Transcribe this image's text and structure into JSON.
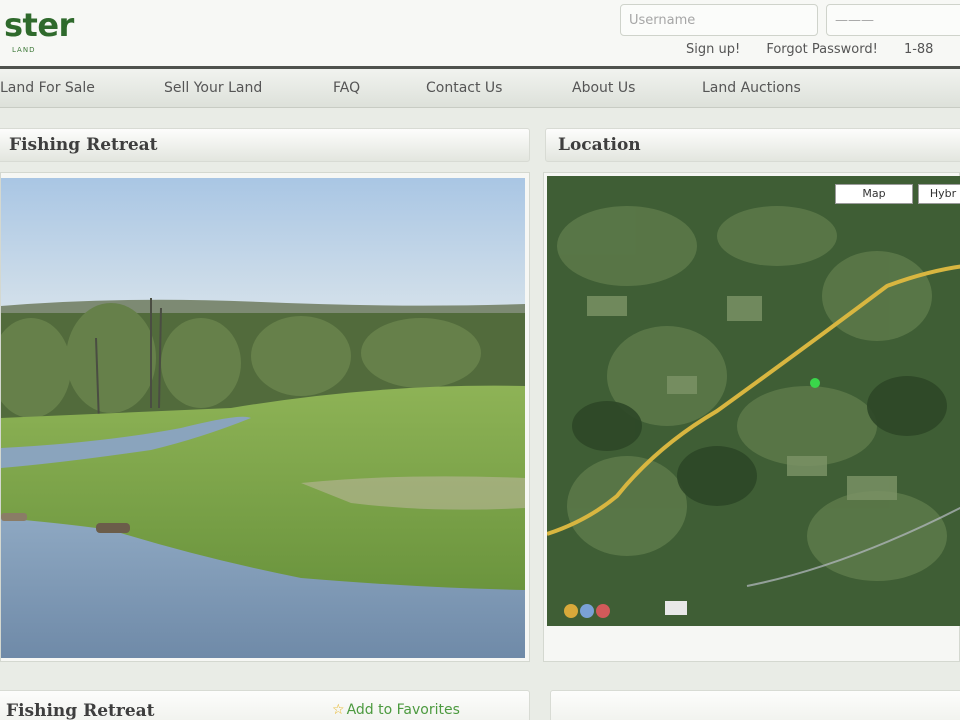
{
  "header": {
    "logo_text": "ster",
    "logo_sub": "LAND",
    "username_placeholder": "Username",
    "password_placeholder": "———",
    "signup": "Sign up!",
    "forgot": "Forgot Password!",
    "phone": "1-88"
  },
  "nav": {
    "items": [
      {
        "label": "Land For Sale"
      },
      {
        "label": "Sell Your Land"
      },
      {
        "label": "FAQ"
      },
      {
        "label": "Contact Us"
      },
      {
        "label": "About Us"
      },
      {
        "label": "Land Auctions"
      }
    ]
  },
  "listing": {
    "title": "Fishing Retreat",
    "location_title": "Location",
    "map_button": "Map",
    "hybrid_button": "Hybr",
    "bottom_title": "Fishing Retreat",
    "favorites": "Add to Favorites"
  },
  "colors": {
    "brand_green": "#2f6a2c",
    "nav_border": "#4f524d",
    "favorite_green": "#4c9a3f",
    "road_yellow": "#d8b640"
  },
  "icons": {
    "favorite": "star-icon"
  }
}
